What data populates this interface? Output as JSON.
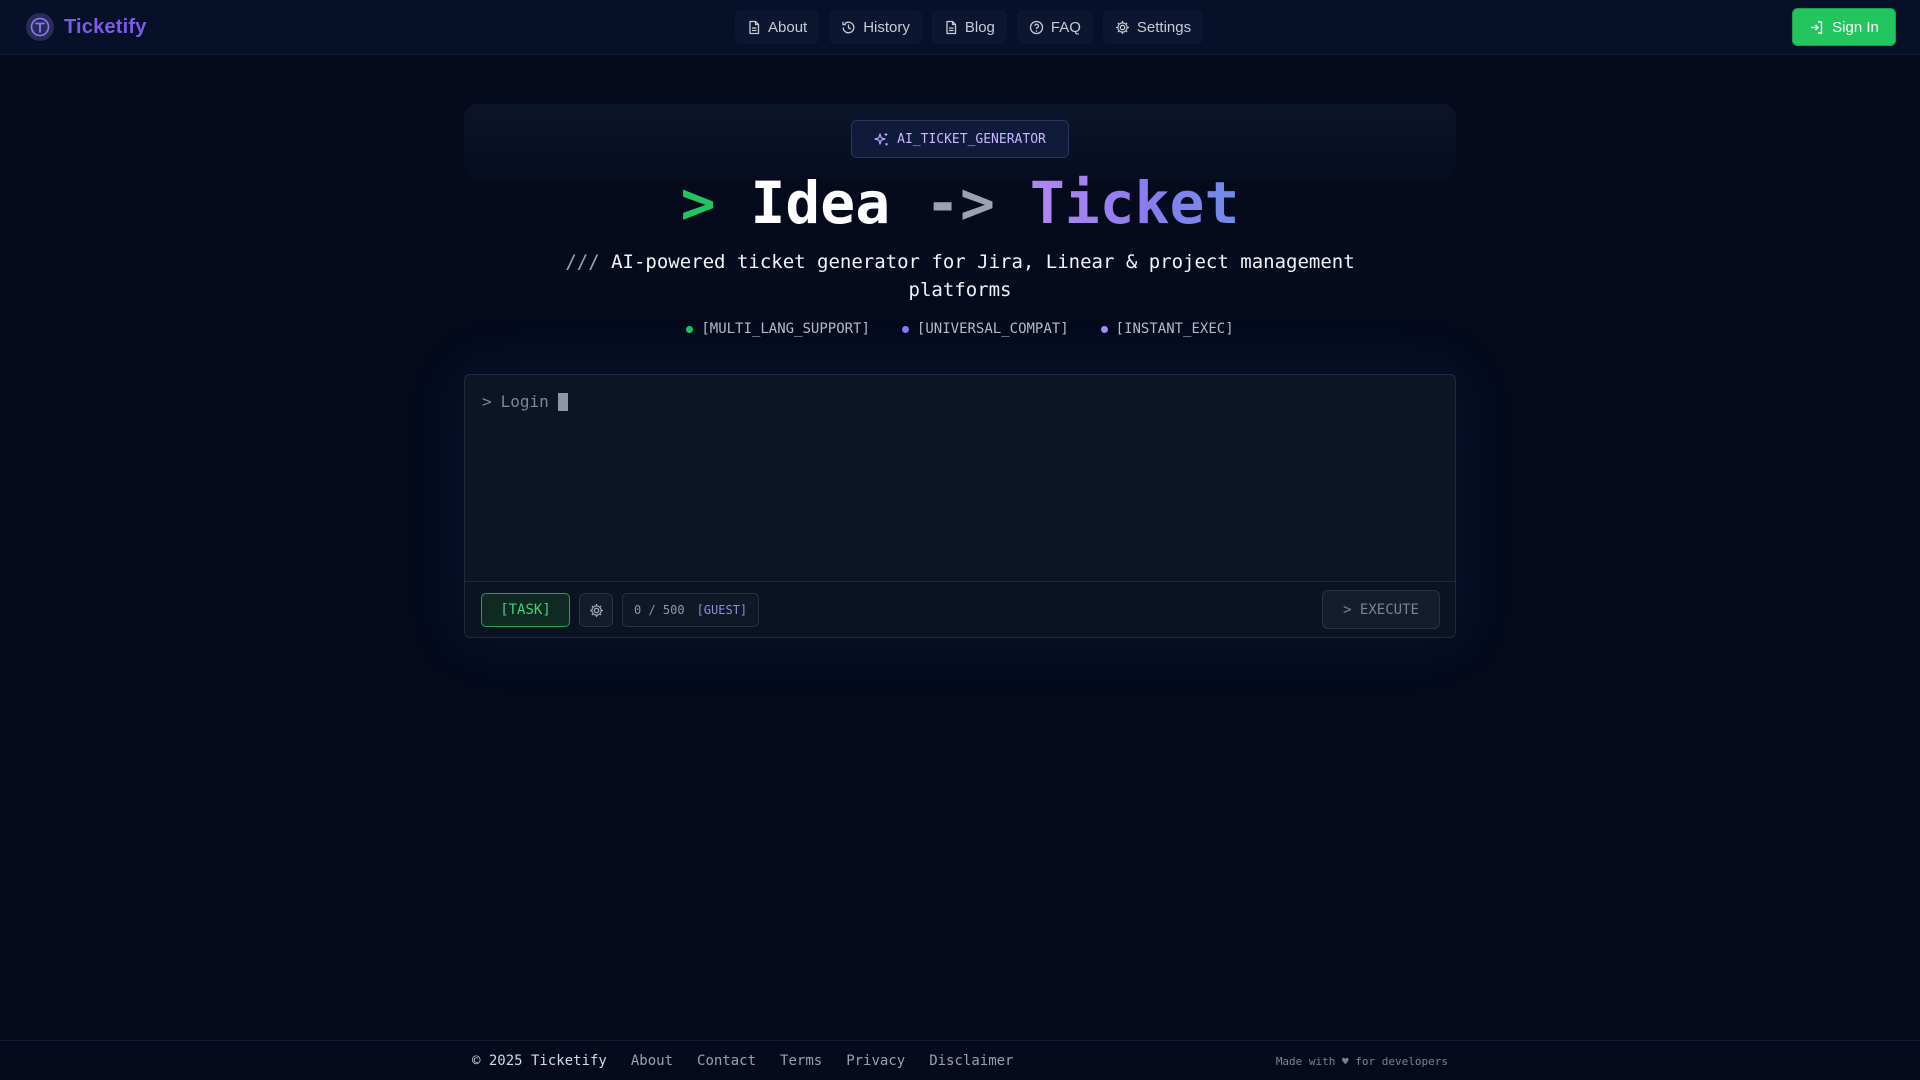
{
  "header": {
    "brand_name": "Ticketify",
    "nav": [
      {
        "label": "About",
        "icon": "file-icon"
      },
      {
        "label": "History",
        "icon": "history-icon"
      },
      {
        "label": "Blog",
        "icon": "file-icon"
      },
      {
        "label": "FAQ",
        "icon": "help-circle-icon"
      },
      {
        "label": "Settings",
        "icon": "gear-icon"
      }
    ],
    "signin_label": "Sign In"
  },
  "hero": {
    "badge": "AI_TICKET_GENERATOR",
    "headline": {
      "prompt": ">",
      "idea": "Idea",
      "arrow": "->",
      "ticket": "Ticket"
    },
    "subtitle_prefix": "///",
    "subtitle": "AI-powered ticket generator for Jira, Linear & project management platforms",
    "features": [
      {
        "label": "[MULTI_LANG_SUPPORT]",
        "color": "#22c55e"
      },
      {
        "label": "[UNIVERSAL_COMPAT]",
        "color": "#8b7cf0"
      },
      {
        "label": "[INSTANT_EXEC]",
        "color": "#a78bfa"
      }
    ]
  },
  "terminal": {
    "prompt_symbol": ">",
    "input_value": "Login",
    "task_label": "[TASK]",
    "counter": "0 / 500",
    "counter_tag": "[GUEST]",
    "execute_label": "> EXECUTE"
  },
  "footer": {
    "copyright": "© 2025 Ticketify",
    "links": [
      "About",
      "Contact",
      "Terms",
      "Privacy",
      "Disclaimer"
    ],
    "made_with": "Made with ♥ for developers"
  },
  "colors": {
    "background": "#050b1d",
    "brand": "#7c5ce6",
    "accent_green": "#22c55e",
    "accent_purple": "#8b7cf0"
  }
}
